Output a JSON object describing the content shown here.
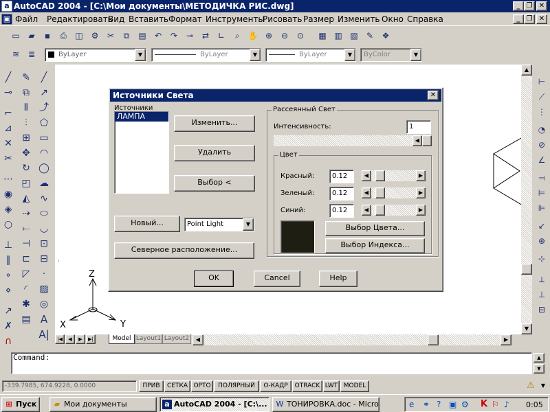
{
  "window": {
    "title": "AutoCAD 2004 - [C:\\Мои документы\\МЕТОДИЧКА РИС.dwg]"
  },
  "menu": [
    "Файл",
    "Редактировать",
    "Вид",
    "Вставить",
    "Формат",
    "Инструменты",
    "Рисовать",
    "Размер",
    "Изменить",
    "Окно",
    "Справка"
  ],
  "properties_bar": {
    "color": "ByLayer",
    "linetype": "ByLayer",
    "lineweight": "ByLayer",
    "plotstyle": "ByColor"
  },
  "dialog": {
    "title": "Источники Света",
    "lights_label": "Источники",
    "lights": [
      "ЛАМПА"
    ],
    "modify_button": "Изменить...",
    "delete_button": "Удалить",
    "select_button": "Выбор <",
    "new_button": "Новый...",
    "light_type": "Point Light",
    "north_button": "Северное расположение...",
    "ambient": {
      "label": "Рассеянный Свет",
      "intensity_label": "Интенсивность:",
      "intensity_value": "1",
      "color_label": "Цвет",
      "red_label": "Красный:",
      "red_value": "0.12",
      "green_label": "Зеленый:",
      "green_value": "0.12",
      "blue_label": "Синий:",
      "blue_value": "0.12",
      "swatch_color": "#1e1e12",
      "color_select_button": "Выбор Цвета...",
      "index_select_button": "Выбор Индекса..."
    },
    "ok_button": "OK",
    "cancel_button": "Cancel",
    "help_button": "Help"
  },
  "ucs": {
    "x": "X",
    "y": "Y",
    "z": "Z"
  },
  "layout_tabs": [
    "Model",
    "Layout1",
    "Layout2"
  ],
  "command": {
    "prompt": "Command:"
  },
  "status": {
    "coords": "-339.7985, 674.9228, 0.0000",
    "toggles": [
      "ПРИВ",
      "СЕТКА",
      "ОРТО",
      "ПОЛЯРНЫЙ",
      "О-КАДР",
      "OTRACK",
      "LWT",
      "MODEL"
    ]
  },
  "taskbar": {
    "start": "Пуск",
    "tasks": [
      {
        "label": "Мои документы",
        "icon": "folder-icon"
      },
      {
        "label": "AutoCAD 2004 - [C:\\...",
        "icon": "autocad-icon"
      },
      {
        "label": "ТОНИРОВКА.doc - Micro...",
        "icon": "word-icon"
      }
    ],
    "clock": "0:05"
  }
}
